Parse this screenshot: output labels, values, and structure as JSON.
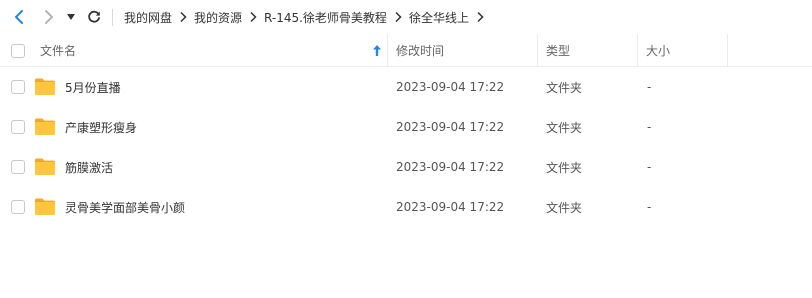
{
  "nav": {
    "back_icon": "chevron-left-icon",
    "forward_icon": "chevron-right-icon",
    "dropdown_icon": "caret-down-icon",
    "refresh_icon": "refresh-icon"
  },
  "breadcrumb": [
    "我的网盘",
    "我的资源",
    "R-145.徐老师骨美教程",
    "徐全华线上"
  ],
  "columns": {
    "name": "文件名",
    "modified": "修改时间",
    "type": "类型",
    "size": "大小",
    "sort_icon": "sort-up-arrow-icon"
  },
  "rows": [
    {
      "name": "5月份直播",
      "modified": "2023-09-04 17:22",
      "type": "文件夹",
      "size": "-"
    },
    {
      "name": "产康塑形瘦身",
      "modified": "2023-09-04 17:22",
      "type": "文件夹",
      "size": "-"
    },
    {
      "name": "筋膜激活",
      "modified": "2023-09-04 17:22",
      "type": "文件夹",
      "size": "-"
    },
    {
      "name": "灵骨美学面部美骨小颜",
      "modified": "2023-09-04 17:22",
      "type": "文件夹",
      "size": "-"
    }
  ],
  "colors": {
    "accent": "#1e88e5",
    "folder": "#ffc53d",
    "folder_dark": "#f5a623"
  }
}
